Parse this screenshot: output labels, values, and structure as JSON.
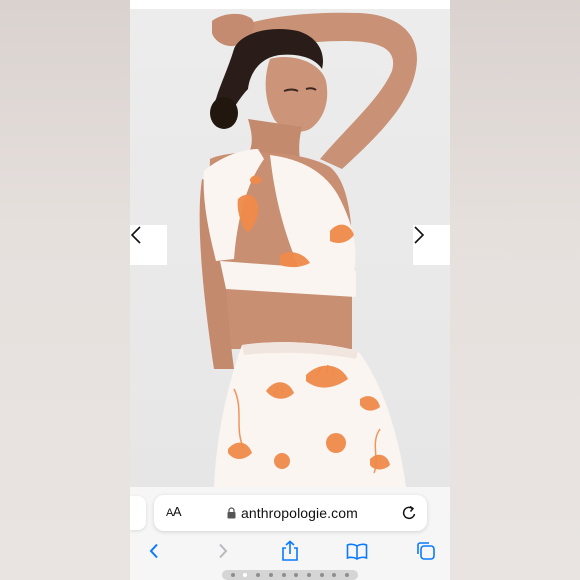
{
  "browser": {
    "domain": "anthropologie.com",
    "text_size_button": "AA",
    "url_secure": true
  },
  "carousel": {
    "prev_icon": "chevron-left-icon",
    "next_icon": "chevron-right-icon"
  },
  "product_image": {
    "accent_color": "#ef8a4a",
    "dress_color": "#fbf5f1"
  },
  "toolbar": {
    "back_icon": "chevron-left-icon",
    "forward_icon": "chevron-right-icon",
    "share_icon": "share-icon",
    "bookmarks_icon": "book-icon",
    "tabs_icon": "tabs-icon"
  },
  "colors": {
    "ios_blue": "#0a7aff",
    "disabled_gray": "#b8b8bf"
  }
}
